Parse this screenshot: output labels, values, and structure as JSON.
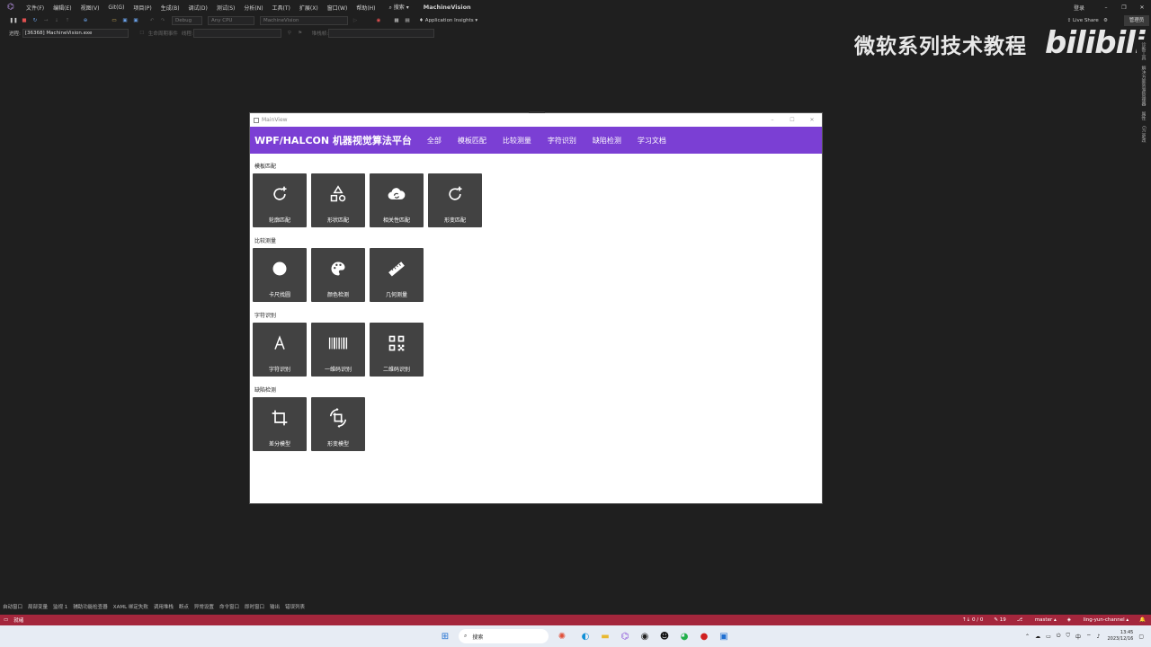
{
  "vs": {
    "menu": [
      "文件(F)",
      "编辑(E)",
      "视图(V)",
      "Git(G)",
      "项目(P)",
      "生成(B)",
      "调试(D)",
      "测试(S)",
      "分析(N)",
      "工具(T)",
      "扩展(X)",
      "窗口(W)",
      "帮助(H)"
    ],
    "search_label": "搜索",
    "solution_title": "MachineVision",
    "signin_label": "登录",
    "live_share_label": "Live Share",
    "admin_label": "管理员",
    "toolbar_config": "Debug",
    "toolbar_platform": "Any CPU",
    "toolbar_project": "MachineVision",
    "app_insights_label": "Application Insights",
    "process_label": "进程:",
    "process_value": "[36368] MachineVision.exe",
    "lifecycle_label": "生命周期事件",
    "thread_label": "线程:",
    "stack_label": "堆栈帧:",
    "bottom_tabs": [
      "自动窗口",
      "局部变量",
      "监视 1",
      "辅助功能检查器",
      "XAML 绑定失败",
      "调用堆栈",
      "断点",
      "异常设置",
      "命令窗口",
      "即时窗口",
      "输出",
      "错误列表"
    ],
    "side_tabs": [
      "诊断工具",
      "解决方案资源管理器",
      "属性",
      "Git 更改"
    ],
    "status": {
      "ready": "就绪",
      "errors": "↑↓ 0 / 0",
      "edits": "✎ 19",
      "branch": "master",
      "channel": "ling-yun-channel"
    }
  },
  "watermark": {
    "text": "微软系列技术教程",
    "logo": "bilibili"
  },
  "app": {
    "window_title": "MainView",
    "header_title": "WPF/HALCON 机器视觉算法平台",
    "nav": [
      "全部",
      "模板匹配",
      "比较测量",
      "字符识别",
      "缺陷检测",
      "学习文档"
    ],
    "sections": [
      {
        "title": "模板匹配",
        "tiles": [
          {
            "label": "轮廓匹配",
            "icon": "refresh-plus-icon"
          },
          {
            "label": "形状匹配",
            "icon": "shapes-icon"
          },
          {
            "label": "相关性匹配",
            "icon": "cloud-sync-icon"
          },
          {
            "label": "形变匹配",
            "icon": "refresh-plus-icon"
          }
        ]
      },
      {
        "title": "比较测量",
        "tiles": [
          {
            "label": "卡尺找圆",
            "icon": "circle-icon"
          },
          {
            "label": "颜色检测",
            "icon": "palette-icon"
          },
          {
            "label": "几何测量",
            "icon": "ruler-icon"
          }
        ]
      },
      {
        "title": "字符识别",
        "tiles": [
          {
            "label": "字符识别",
            "icon": "letter-a-icon"
          },
          {
            "label": "一维码识别",
            "icon": "barcode-icon"
          },
          {
            "label": "二维码识别",
            "icon": "qrcode-icon"
          }
        ]
      },
      {
        "title": "缺陷检测",
        "tiles": [
          {
            "label": "差分模型",
            "icon": "crop-icon"
          },
          {
            "label": "形变模型",
            "icon": "crop-rotate-icon"
          }
        ]
      }
    ]
  },
  "taskbar": {
    "search_label": "搜索",
    "ime": "中",
    "time": "13:45",
    "date": "2023/12/16"
  }
}
